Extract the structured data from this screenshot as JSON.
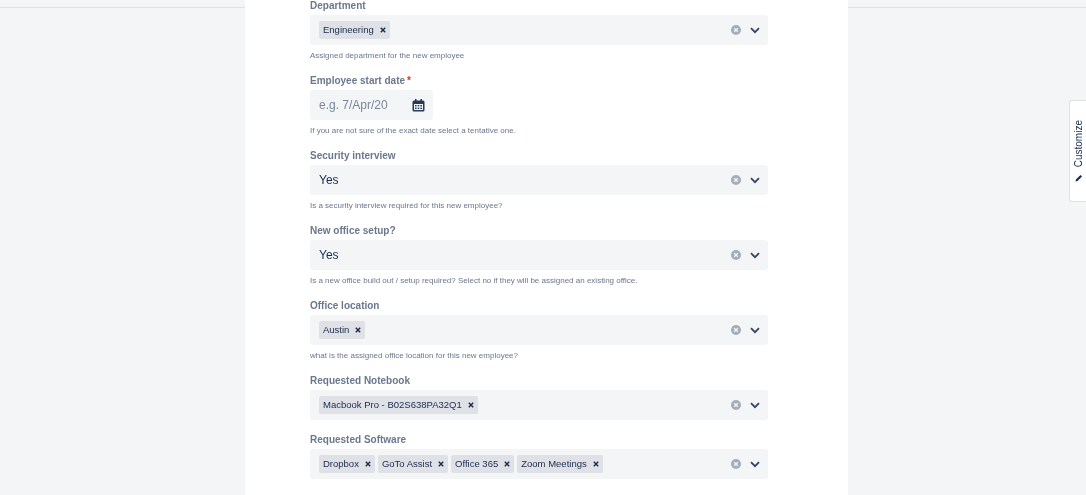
{
  "fields": [
    {
      "kind": "multi",
      "label": "Department",
      "required": false,
      "tags": [
        "Engineering"
      ],
      "help": "Assigned department for the new employee"
    },
    {
      "kind": "date",
      "label": "Employee start date",
      "required": true,
      "placeholder": "e.g. 7/Apr/20",
      "help": "If you are not sure of the exact date select a tentative one."
    },
    {
      "kind": "single",
      "label": "Security interview",
      "required": false,
      "value": "Yes",
      "help": "Is a security interview required for this new employee?"
    },
    {
      "kind": "single",
      "label": "New office setup?",
      "required": false,
      "value": "Yes",
      "help": "Is a new office build out / setup required? Select no if they will be assigned an existing office."
    },
    {
      "kind": "multi",
      "label": "Office location",
      "required": false,
      "tags": [
        "Austin"
      ],
      "help": "what is the assigned office location for this new employee?"
    },
    {
      "kind": "multi",
      "label": "Requested Notebook",
      "required": false,
      "tags": [
        "Macbook Pro - B02S638PA32Q1"
      ]
    },
    {
      "kind": "multi",
      "label": "Requested Software",
      "required": false,
      "tags": [
        "Dropbox",
        "GoTo Assist",
        "Office 365",
        "Zoom Meetings"
      ]
    }
  ],
  "required_marker": "*",
  "side_tab": {
    "label": "Customize"
  }
}
